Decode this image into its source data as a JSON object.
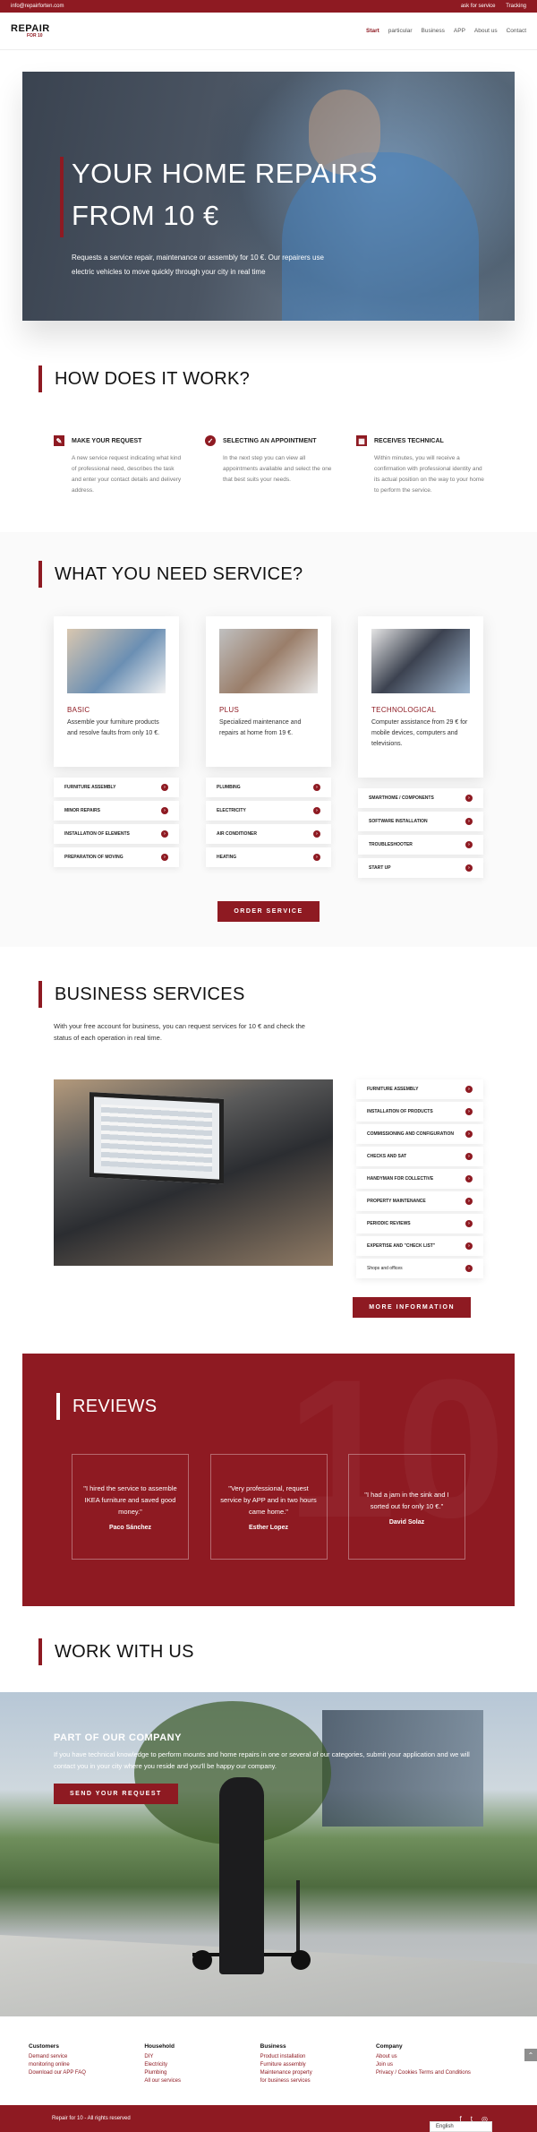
{
  "topbar": {
    "email": "info@repairforten.com",
    "links": [
      "ask for service",
      "Tracking"
    ]
  },
  "header": {
    "logo_line1": "REPAIR",
    "logo_line2": "FOR 10",
    "nav": [
      "Start",
      "particular",
      "Business",
      "APP",
      "About us",
      "Contact"
    ]
  },
  "hero": {
    "title_line1": "YOUR HOME REPAIRS",
    "title_line2": "FROM 10 €",
    "text": "Requests a service repair, maintenance or assembly for 10 €. Our repairers use electric vehicles to move quickly through your city in real time"
  },
  "how": {
    "title": "HOW DOES IT WORK?",
    "steps": [
      {
        "title": "MAKE YOUR REQUEST",
        "text": "A new service request indicating what kind of professional need, describes the task and enter your contact details and delivery address."
      },
      {
        "title": "SELECTING AN APPOINTMENT",
        "text": "In the next step you can view all appointments available and select the one that best suits your needs."
      },
      {
        "title": "RECEIVES TECHNICAL",
        "text": "Within minutes, you will receive a confirmation with professional identity and its actual position on the way to your home to perform the service."
      }
    ]
  },
  "need": {
    "title": "WHAT YOU NEED SERVICE?",
    "cards": [
      {
        "name": "BASIC",
        "desc": "Assemble your furniture products and resolve faults from only 10 €.",
        "items": [
          "FURNITURE ASSEMBLY",
          "MINOR REPAIRS",
          "INSTALLATION OF ELEMENTS",
          "PREPARATION OF MOVING"
        ]
      },
      {
        "name": "PLUS",
        "desc": "Specialized maintenance and repairs at home from 19 €.",
        "items": [
          "PLUMBING",
          "ELECTRICITY",
          "AIR CONDITIONER",
          "HEATING"
        ]
      },
      {
        "name": "TECHNOLOGICAL",
        "desc": "Computer assistance from 29 € for mobile devices, computers and televisions.",
        "items": [
          "SMARTHOME / COMPONENTS",
          "SOFTWARE INSTALLATION",
          "TROUBLESHOOTER",
          "START UP"
        ]
      }
    ],
    "button": "ORDER SERVICE"
  },
  "business": {
    "title": "BUSINESS SERVICES",
    "lead": "With your free account for business, you can request services for 10 € and check the status of each operation in real time.",
    "items": [
      "FURNITURE ASSEMBLY",
      "INSTALLATION OF PRODUCTS",
      "COMMISSIONING AND CONFIGURATION",
      "CHECKS AND SAT",
      "HANDYMAN FOR COLLECTIVE",
      "PROPERTY MAINTENANCE",
      "PERIODIC REVIEWS",
      "EXPERTISE AND \"CHECK LIST\"",
      "Shops and offices"
    ],
    "button": "MORE INFORMATION"
  },
  "reviews": {
    "title": "REVIEWS",
    "items": [
      {
        "quote": "\"I hired the service to assemble IKEA furniture and saved good money.\"",
        "author": "Paco Sánchez"
      },
      {
        "quote": "\"Very professional, request service by APP and in two hours came home.\"",
        "author": "Esther Lopez"
      },
      {
        "quote": "\"I had a jam in the sink and I sorted out for only 10 €.\"",
        "author": "David Solaz"
      }
    ]
  },
  "work": {
    "title": "WORK WITH US",
    "heading": "PART OF OUR COMPANY",
    "text": "If you have technical knowledge to perform mounts and home repairs in one or several of our categories, submit your application and we will contact you in your city where you reside and you'll be happy our company.",
    "button": "SEND YOUR REQUEST"
  },
  "footer": {
    "cols": [
      {
        "title": "Customers",
        "links": [
          "Demand service",
          "monitoring online",
          "Download our APP FAQ"
        ]
      },
      {
        "title": "Household",
        "links": [
          "DIY",
          "Electricity",
          "Plumbing",
          "All our services"
        ]
      },
      {
        "title": "Business",
        "links": [
          "Product installation",
          "Furniture assembly",
          "Maintenance property",
          "for business services"
        ]
      },
      {
        "title": "Company",
        "links": [
          "About us",
          "Join us",
          "Privacy / Cookies Terms and Conditions"
        ]
      }
    ],
    "copyright": "Repair for 10 - All rights reserved",
    "language": "English"
  },
  "colors": {
    "accent": "#8e1a22"
  }
}
